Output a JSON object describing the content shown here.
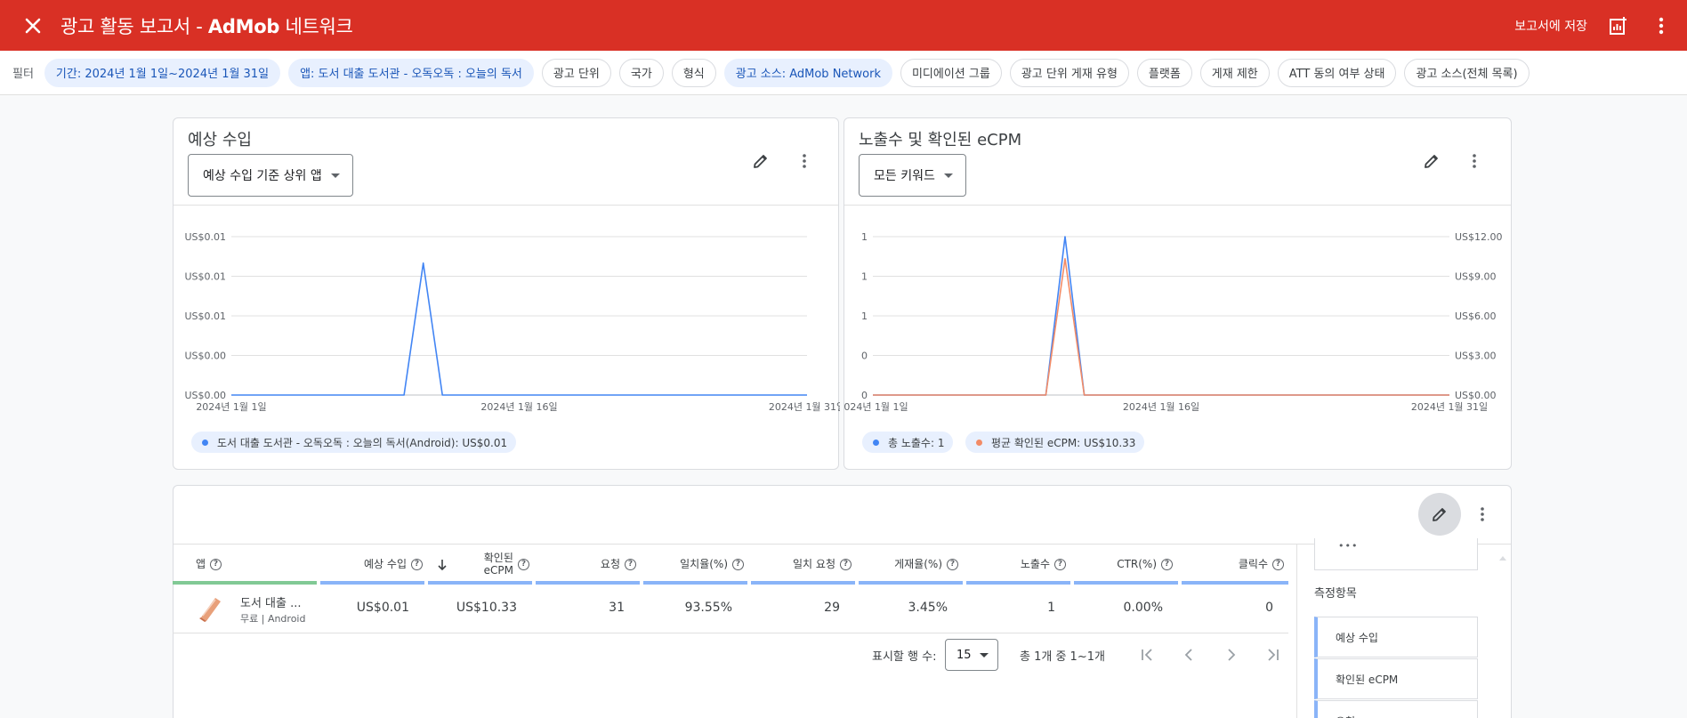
{
  "header": {
    "title_prefix": "광고 활동 보고서 - ",
    "title_brand": "AdMob",
    "title_suffix": " 네트워크",
    "save_label": "보고서에 저장"
  },
  "filters": {
    "label": "필터",
    "chips": [
      {
        "label": "기간: 2024년 1월 1일~2024년 1월 31일",
        "active": true
      },
      {
        "label": "앱: 도서 대출 도서관 - 오독오독 : 오늘의 독서",
        "active": true
      },
      {
        "label": "광고 단위",
        "active": false
      },
      {
        "label": "국가",
        "active": false
      },
      {
        "label": "형식",
        "active": false
      },
      {
        "label": "광고 소스: AdMob Network",
        "active": true
      },
      {
        "label": "미디에이션 그룹",
        "active": false
      },
      {
        "label": "광고 단위 게재 유형",
        "active": false
      },
      {
        "label": "플랫폼",
        "active": false
      },
      {
        "label": "게재 제한",
        "active": false
      },
      {
        "label": "ATT 동의 여부 상태",
        "active": false
      },
      {
        "label": "광고 소스(전체 목록)",
        "active": false
      }
    ]
  },
  "revenue_card": {
    "title": "예상 수입",
    "dropdown": "예상 수입 기준 상위 앱",
    "legend": "도서 대출 도서관 - 오독오독 : 오늘의 독서(Android): US$0.01"
  },
  "impressions_card": {
    "title": "노출수 및 확인된 eCPM",
    "dropdown": "모든 키워드",
    "legend_impressions": "총 노출수: 1",
    "legend_ecpm": "평균 확인된 eCPM: US$10.33"
  },
  "chart_data": [
    {
      "type": "line",
      "title": "예상 수입",
      "x_ticks": [
        "2024년 1월 1일",
        "2024년 1월 16일",
        "2024년 1월 31일"
      ],
      "y_ticks": [
        "US$0.00",
        "US$0.00",
        "US$0.01",
        "US$0.01",
        "US$0.01"
      ],
      "x": [
        1,
        2,
        3,
        4,
        5,
        6,
        7,
        8,
        9,
        10,
        11,
        12,
        13,
        14,
        15,
        16,
        17,
        18,
        19,
        20,
        21,
        22,
        23,
        24,
        25,
        26,
        27,
        28,
        29,
        30,
        31
      ],
      "series": [
        {
          "name": "도서 대출 도서관 - 오독오독 : 오늘의 독서(Android)",
          "color": "#4285f4",
          "values": [
            0,
            0,
            0,
            0,
            0,
            0,
            0,
            0,
            0,
            0,
            0.01,
            0,
            0,
            0,
            0,
            0,
            0,
            0,
            0,
            0,
            0,
            0,
            0,
            0,
            0,
            0,
            0,
            0,
            0,
            0,
            0
          ]
        }
      ],
      "ylim": [
        0,
        0.012
      ]
    },
    {
      "type": "line",
      "title": "노출수 및 확인된 eCPM",
      "x_ticks": [
        "2024년 1월 1일",
        "2024년 1월 16일",
        "2024년 1월 31일"
      ],
      "y_ticks_left": [
        "0",
        "0",
        "1",
        "1",
        "1"
      ],
      "y_ticks_right": [
        "US$0.00",
        "US$3.00",
        "US$6.00",
        "US$9.00",
        "US$12.00"
      ],
      "x": [
        1,
        2,
        3,
        4,
        5,
        6,
        7,
        8,
        9,
        10,
        11,
        12,
        13,
        14,
        15,
        16,
        17,
        18,
        19,
        20,
        21,
        22,
        23,
        24,
        25,
        26,
        27,
        28,
        29,
        30,
        31
      ],
      "series": [
        {
          "name": "총 노출수",
          "axis": "left",
          "color": "#4285f4",
          "values": [
            0,
            0,
            0,
            0,
            0,
            0,
            0,
            0,
            0,
            0,
            1,
            0,
            0,
            0,
            0,
            0,
            0,
            0,
            0,
            0,
            0,
            0,
            0,
            0,
            0,
            0,
            0,
            0,
            0,
            0,
            0
          ]
        },
        {
          "name": "평균 확인된 eCPM",
          "axis": "right",
          "color": "#f28b66",
          "values": [
            0,
            0,
            0,
            0,
            0,
            0,
            0,
            0,
            0,
            0,
            10.33,
            0,
            0,
            0,
            0,
            0,
            0,
            0,
            0,
            0,
            0,
            0,
            0,
            0,
            0,
            0,
            0,
            0,
            0,
            0,
            0
          ]
        }
      ],
      "ylim_left": [
        0,
        1
      ],
      "ylim_right": [
        0,
        12
      ]
    }
  ],
  "table": {
    "columns": {
      "app": "앱",
      "revenue": "예상 수입",
      "ecpm_line1": "확인된",
      "ecpm_line2": "eCPM",
      "requests": "요청",
      "match_rate": "일치율(%)",
      "matched_requests": "일치 요청",
      "show_rate": "게재율(%)",
      "impressions": "노출수",
      "ctr": "CTR(%)",
      "clicks": "클릭수"
    },
    "row": {
      "app_name": "도서 대출 ...",
      "app_sub": "무료 | Android",
      "revenue": "US$0.01",
      "ecpm": "US$10.33",
      "requests": "31",
      "match_rate": "93.55%",
      "matched_requests": "29",
      "show_rate": "3.45%",
      "impressions": "1",
      "ctr": "0.00%",
      "clicks": "0"
    },
    "pagination": {
      "rows_label": "표시할 행 수:",
      "rows_value": "15",
      "count": "총 1개 중 1~1개"
    },
    "colors": {
      "dimension": "#81c995",
      "metric": "#8ab4f8"
    }
  },
  "metrics_panel": {
    "title": "측정항목",
    "items": [
      "예상 수입",
      "확인된 eCPM",
      "요청"
    ]
  }
}
